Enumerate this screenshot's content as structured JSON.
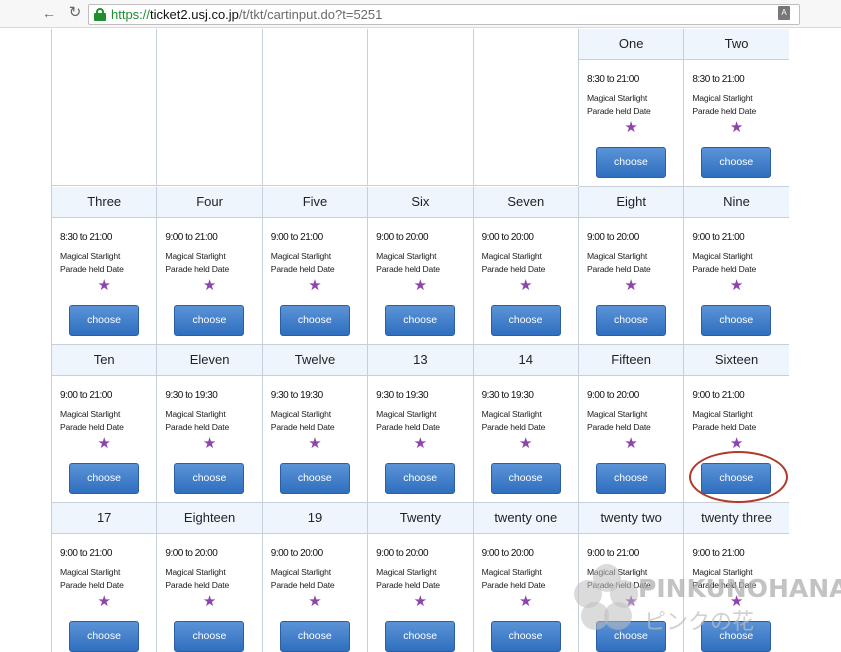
{
  "browser": {
    "url_scheme": "https://",
    "url_host": "ticket2.usj.co.jp",
    "url_path": "/t/tkt/cartinput.do?t=5251"
  },
  "calendar": {
    "note_line1": "Magical Starlight",
    "note_line2": "Parade held Date",
    "star": "★",
    "button_label": "choose",
    "days": [
      {
        "label": "One",
        "time": "8:30 to 21:00"
      },
      {
        "label": "Two",
        "time": "8:30 to 21:00"
      },
      {
        "label": "Three",
        "time": "8:30 to 21:00"
      },
      {
        "label": "Four",
        "time": "9:00 to 21:00"
      },
      {
        "label": "Five",
        "time": "9:00 to 21:00"
      },
      {
        "label": "Six",
        "time": "9:00 to 20:00"
      },
      {
        "label": "Seven",
        "time": "9:00 to 20:00"
      },
      {
        "label": "Eight",
        "time": "9:00 to 20:00"
      },
      {
        "label": "Nine",
        "time": "9:00 to 21:00"
      },
      {
        "label": "Ten",
        "time": "9:00 to 21:00"
      },
      {
        "label": "Eleven",
        "time": "9:30 to 19:30"
      },
      {
        "label": "Twelve",
        "time": "9:30 to 19:30"
      },
      {
        "label": "13",
        "time": "9:30 to 19:30"
      },
      {
        "label": "14",
        "time": "9:30 to 19:30"
      },
      {
        "label": "Fifteen",
        "time": "9:00 to 20:00"
      },
      {
        "label": "Sixteen",
        "time": "9:00 to 21:00"
      },
      {
        "label": "17",
        "time": "9:00 to 21:00"
      },
      {
        "label": "Eighteen",
        "time": "9:00 to 20:00"
      },
      {
        "label": "19",
        "time": "9:00 to 20:00"
      },
      {
        "label": "Twenty",
        "time": "9:00 to 20:00"
      },
      {
        "label": "twenty one",
        "time": "9:00 to 20:00"
      },
      {
        "label": "twenty two",
        "time": "9:00 to 21:00"
      },
      {
        "label": "twenty three",
        "time": "9:00 to 21:00"
      }
    ]
  },
  "watermark": {
    "brand": "PINKUNOHANA",
    "brand_jp": "ピンクの花"
  },
  "colors": {
    "button": "#3a7bc8",
    "star": "#8e44ad",
    "highlight": "#b23a2a",
    "header_bg": "#eef5fc"
  },
  "icons": [
    "back-arrow-icon",
    "reload-icon",
    "lock-icon",
    "translate-icon",
    "star-icon",
    "flower-logo-icon"
  ]
}
